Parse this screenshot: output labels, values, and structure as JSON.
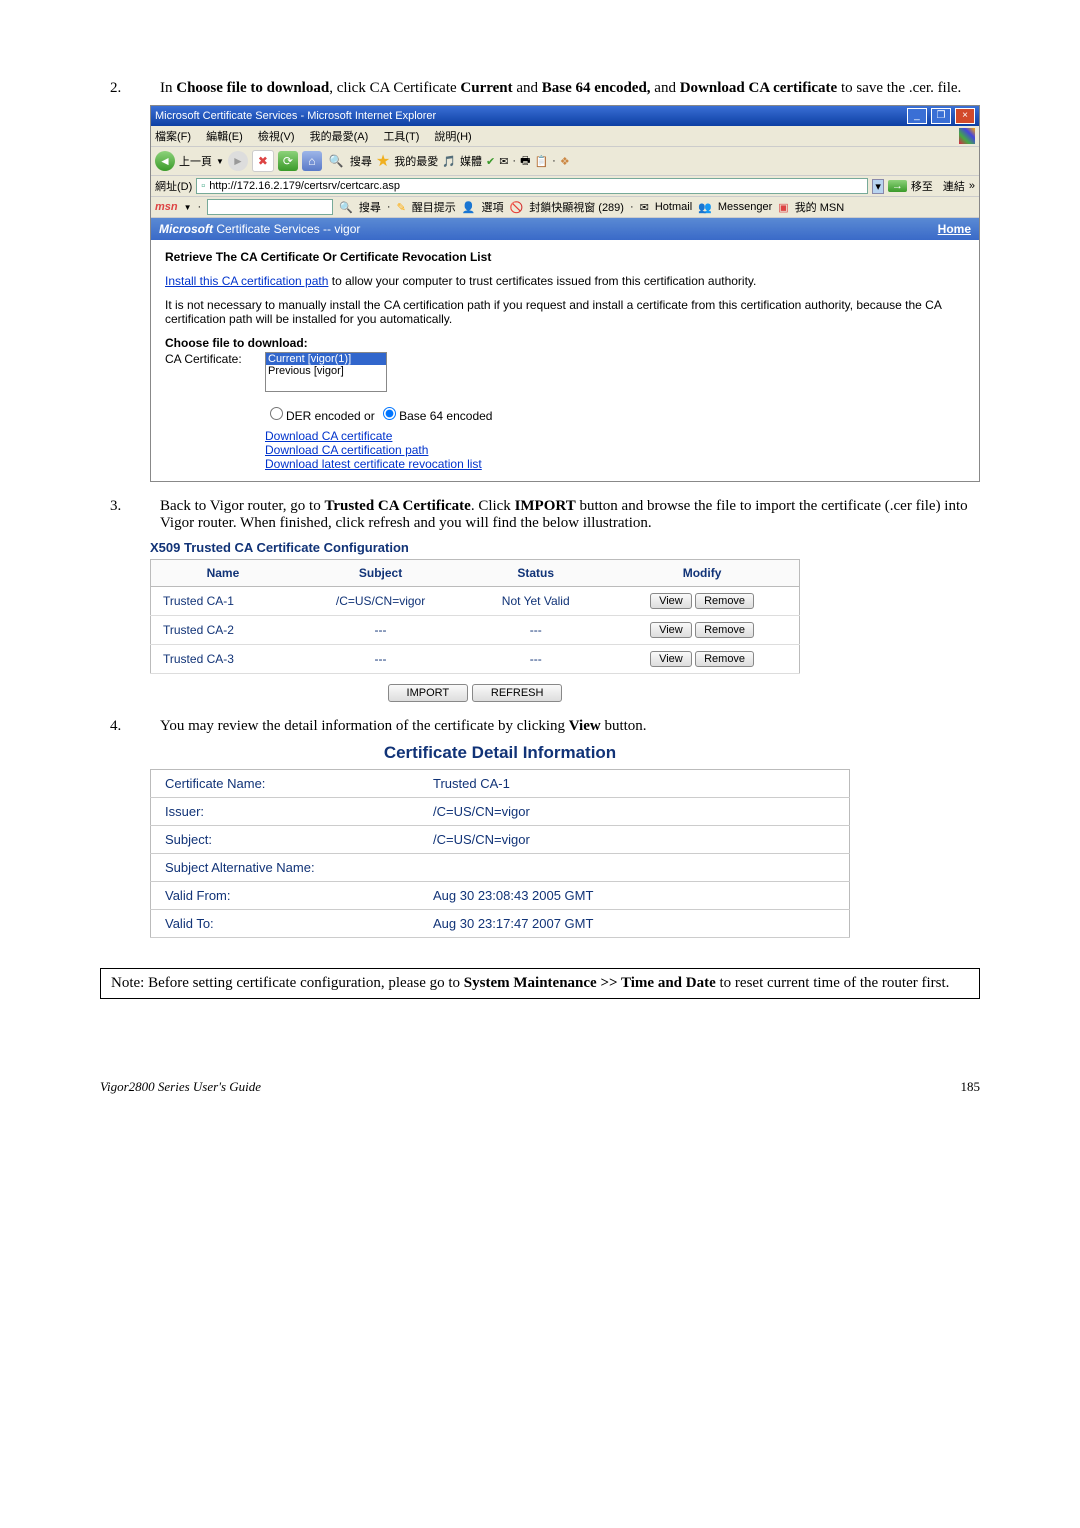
{
  "step2": {
    "num": "2.",
    "text_parts": [
      "In ",
      "Choose file to download",
      ", click CA Certificate ",
      "Current",
      " and ",
      "Base 64 encoded,",
      " and ",
      "Download CA certificate",
      " to save the .cer. file."
    ]
  },
  "ie": {
    "title": "Microsoft Certificate Services - Microsoft Internet Explorer",
    "menu": [
      "檔案(F)",
      "編輯(E)",
      "檢視(V)",
      "我的最愛(A)",
      "工具(T)",
      "說明(H)"
    ],
    "back": "上一頁",
    "toolbar_search": "搜尋",
    "toolbar_fav": "我的最愛",
    "toolbar_media": "媒體",
    "address_label": "網址(D)",
    "url": "http://172.16.2.179/certsrv/certcarc.asp",
    "go": "移至",
    "links": "連結",
    "msn": "msn",
    "msn_search": "搜尋",
    "msn_highlight": "醒目提示",
    "msn_options": "選項",
    "msn_blocker": "封鎖快顯視窗 (289)",
    "msn_hotmail": "Hotmail",
    "msn_messenger": "Messenger",
    "msn_mymsn": "我的 MSN"
  },
  "cert": {
    "header_left_ms": "Microsoft",
    "header_left_rest": " Certificate Services  --  vigor",
    "header_right": "Home",
    "body_title": "Retrieve The CA Certificate Or Certificate Revocation List",
    "link1": "Install this CA certification path",
    "link1_rest": " to allow your computer to trust certificates issued from this certification authority.",
    "para2": "It is not necessary to manually install the CA certification path if you request and install a certificate from this certification authority, because the CA certification path will be installed for you automatically.",
    "choose_label": "Choose file to download:",
    "ca_cert_label": "CA Certificate:",
    "list_current": "Current [vigor(1)]",
    "list_previous": "Previous [vigor]",
    "radio_der": "DER encoded   or   ",
    "radio_b64": "Base 64 encoded",
    "dl1": "Download CA certificate",
    "dl2": "Download CA certification path",
    "dl3": "Download latest certificate revocation list"
  },
  "step3": {
    "num": "3.",
    "text_parts": [
      "Back to Vigor router, go to ",
      "Trusted CA Certificate",
      ". Click ",
      "IMPORT",
      " button and browse the file to import the certificate (.cer file) into Vigor router. When finished, click refresh and you will find the below illustration."
    ]
  },
  "trusted": {
    "title": "X509 Trusted CA Certificate Configuration",
    "headers": [
      "Name",
      "Subject",
      "Status",
      "Modify"
    ],
    "rows": [
      {
        "name": "Trusted CA-1",
        "subject": "/C=US/CN=vigor",
        "status": "Not Yet Valid"
      },
      {
        "name": "Trusted CA-2",
        "subject": "---",
        "status": "---"
      },
      {
        "name": "Trusted CA-3",
        "subject": "---",
        "status": "---"
      }
    ],
    "view": "View",
    "remove": "Remove",
    "import": "IMPORT",
    "refresh": "REFRESH"
  },
  "step4": {
    "num": "4.",
    "text_parts": [
      "You may review the detail information of the certificate by clicking ",
      "View",
      " button."
    ]
  },
  "detail": {
    "title": "Certificate Detail Information",
    "rows": [
      {
        "label": "Certificate Name:",
        "value": "Trusted CA-1"
      },
      {
        "label": "Issuer:",
        "value": "/C=US/CN=vigor"
      },
      {
        "label": "Subject:",
        "value": "/C=US/CN=vigor"
      },
      {
        "label": "Subject Alternative Name:",
        "value": ""
      },
      {
        "label": "Valid From:",
        "value": "Aug 30 23:08:43 2005 GMT"
      },
      {
        "label": "Valid To:",
        "value": "Aug 30 23:17:47 2007 GMT"
      }
    ]
  },
  "note": {
    "parts": [
      "Note: Before setting certificate configuration, please go to ",
      "System Maintenance >> Time and Date",
      " to reset current time of the router first."
    ]
  },
  "footer": {
    "left": "Vigor2800 Series User's Guide",
    "right": "185"
  }
}
